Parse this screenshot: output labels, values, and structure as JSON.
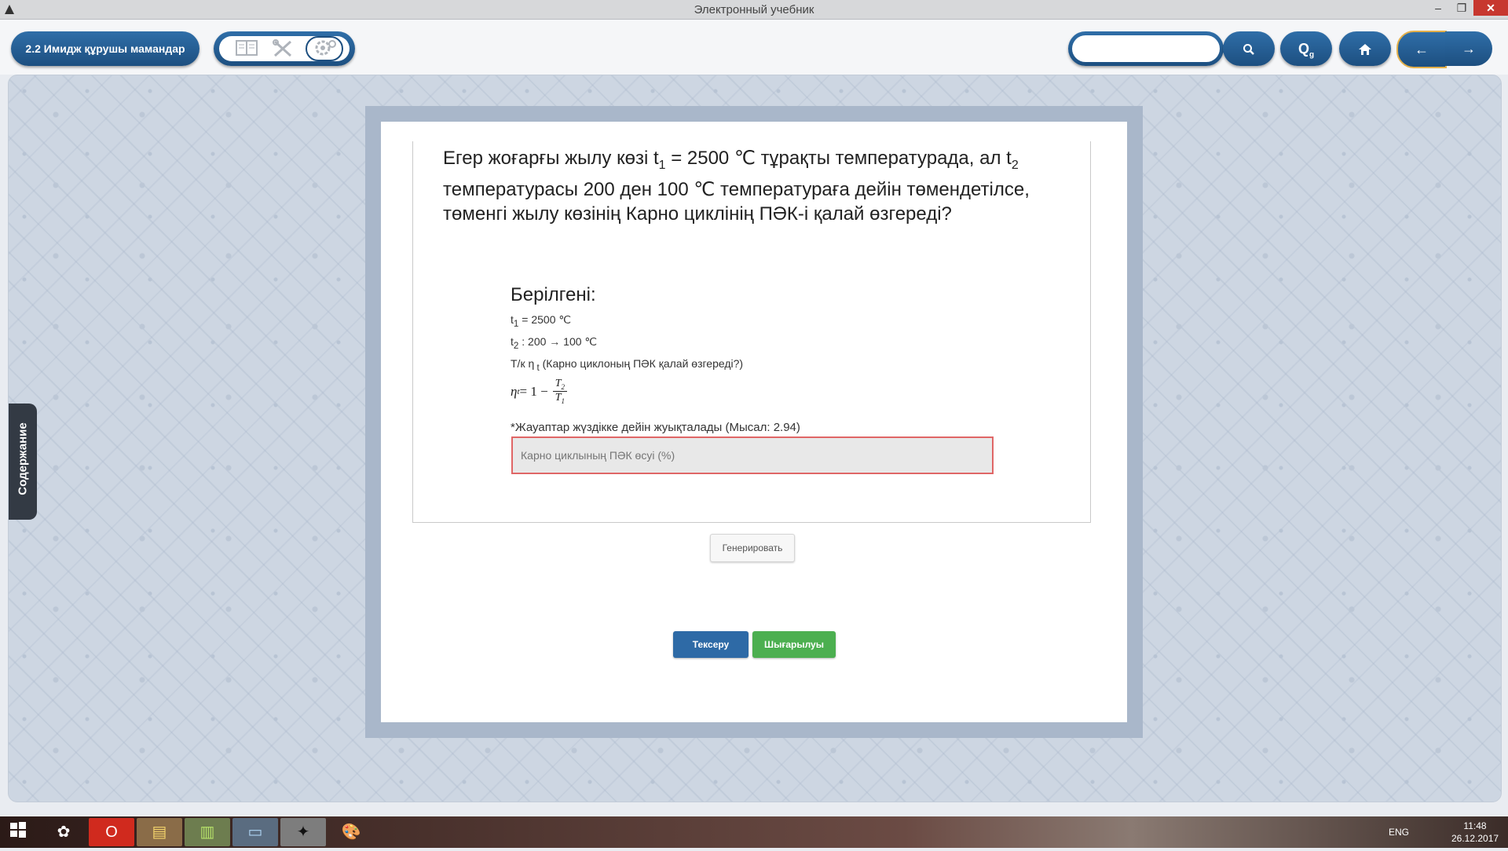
{
  "window": {
    "title": "Электронный учебник",
    "controls": [
      "–",
      "❐",
      "✕"
    ]
  },
  "toolbar": {
    "section_label": "2.2 Имидж құрушы мамандар",
    "search_placeholder": "",
    "search_icon": "🔍",
    "glossary_search_label": "Q",
    "glossary_search_sub": "g",
    "home_icon": "⌂",
    "back_icon": "←",
    "forward_icon": "→"
  },
  "sidebar": {
    "contents_label": "Содержание"
  },
  "exercise": {
    "question": {
      "p1": "Егер жоғарғы жылу көзі t",
      "sub1": "1",
      "p2": " = 2500 ℃ тұрақты температурада, ал t",
      "sub2": "2",
      "p3": " температурасы 200 ден 100 ℃ температураға дейін төмендетілсе, төменгі жылу көзінің  Карно циклінің ПӘК-і қалай өзгереді?"
    },
    "given_title": "Берілгені:",
    "given": {
      "l1_pre": "t",
      "l1_sub": "1",
      "l1_post": " = 2500 ℃",
      "l2_pre": "t",
      "l2_sub": "2",
      "l2_post": " : 200 → 100 ℃",
      "l3_pre": "Т/к η",
      "l3_sub": " t",
      "l3_post": " (Карно циклоның ПӘК қалай өзгереді?)"
    },
    "formula": {
      "lhs": "η",
      "lhs_sub": "t",
      "rhs": " = 1 − ",
      "num": "T",
      "num_sub": "2",
      "den": "T",
      "den_sub": "1"
    },
    "note": "*Жауаптар жүздікке дейін жуықталады (Мысал: 2.94)",
    "answer_placeholder": "Карно циклының ПӘК өсуі (%)",
    "generate_label": "Генерировать",
    "check_label": "Тексеру",
    "solution_label": "Шығарылуы"
  },
  "taskbar": {
    "lang": "ENG",
    "time": "11:48",
    "date": "26.12.2017"
  },
  "colors": {
    "accent": "#1d4f80",
    "check_button": "#2e6aa6",
    "solution_button": "#4caf50",
    "input_border": "#e06666"
  }
}
